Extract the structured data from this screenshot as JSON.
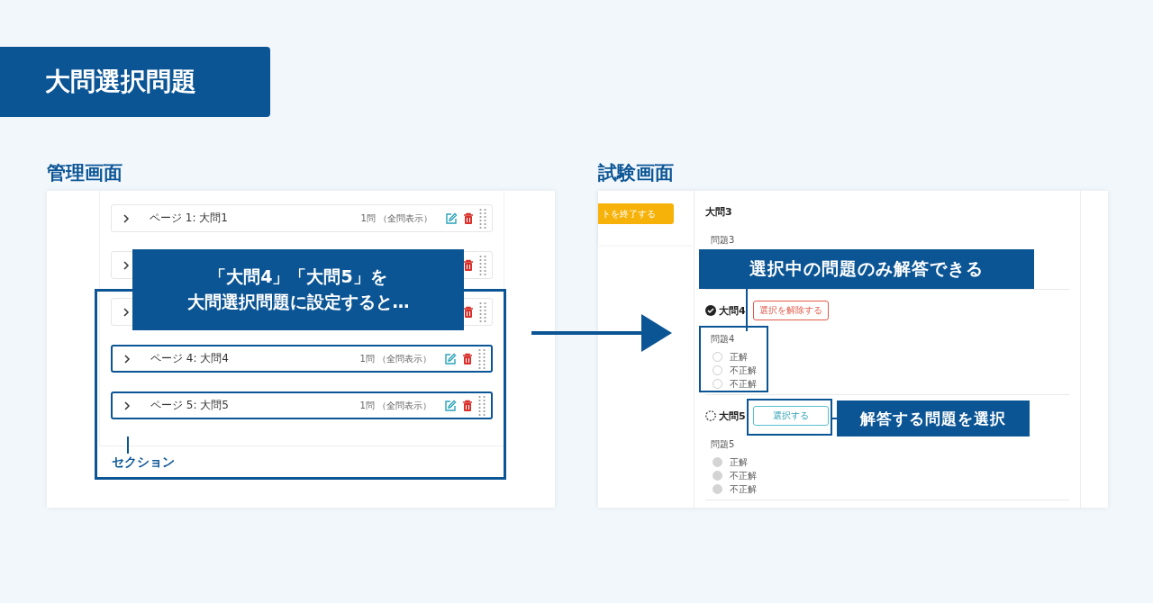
{
  "banner": {
    "title": "大問選択問題"
  },
  "admin": {
    "heading": "管理画面",
    "rows": [
      {
        "label": "ページ 1: 大問1",
        "count": "1問 （全問表示）",
        "highlighted": false
      },
      {
        "highlighted": false
      },
      {
        "highlighted": false
      },
      {
        "label": "ページ 4: 大問4",
        "count": "1問 （全問表示）",
        "highlighted": true
      },
      {
        "label": "ページ 5: 大問5",
        "count": "1問 （全問表示）",
        "highlighted": true
      }
    ],
    "callout_lines": [
      "「大問4」「大問5」を",
      "大問選択問題に設定すると…"
    ],
    "section_label": "セクション"
  },
  "exam": {
    "heading": "試験画面",
    "finish_button": "トを終了する",
    "sections": [
      {
        "title": "大問3",
        "question": "問題3"
      },
      {
        "title": "大問4",
        "selected": true,
        "button": "選択を解除する",
        "question": "問題4",
        "options": [
          {
            "label": "正解",
            "disabled": false
          },
          {
            "label": "不正解",
            "disabled": false
          },
          {
            "label": "不正解",
            "disabled": false
          }
        ]
      },
      {
        "title": "大問5",
        "selected": false,
        "button": "選択する",
        "question": "問題5",
        "options": [
          {
            "label": "正解",
            "disabled": true
          },
          {
            "label": "不正解",
            "disabled": true
          },
          {
            "label": "不正解",
            "disabled": true
          }
        ]
      }
    ],
    "answer_note": "選択中の問題のみ解答できる",
    "select_note": "解答する問題を選択"
  }
}
